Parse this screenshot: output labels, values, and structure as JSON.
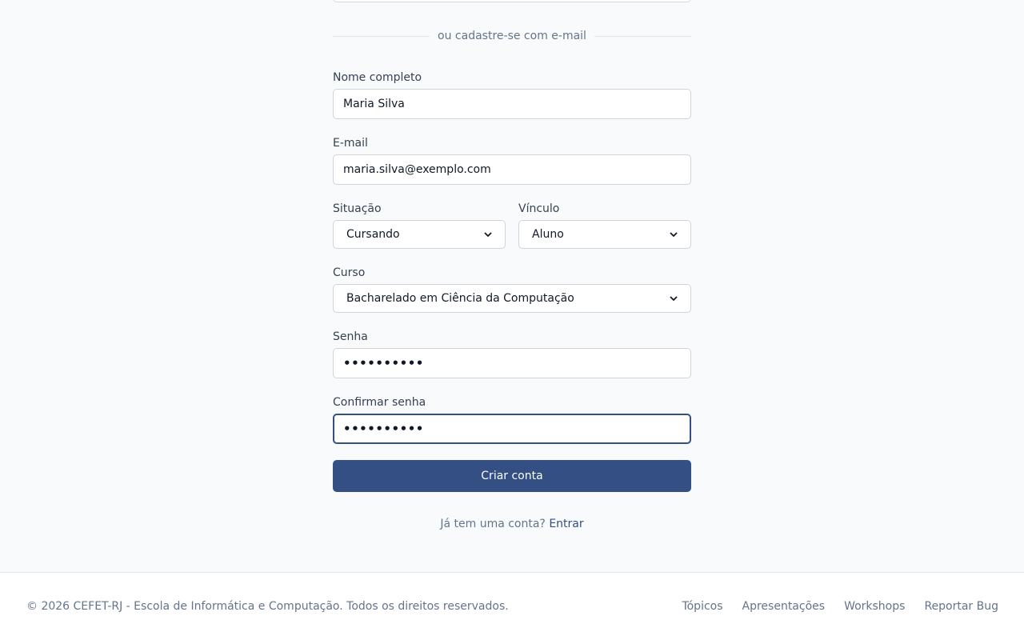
{
  "divider": {
    "text": "ou cadastre-se com e-mail"
  },
  "form": {
    "name": {
      "label": "Nome completo",
      "value": "Maria Silva"
    },
    "email": {
      "label": "E-mail",
      "value": "maria.silva@exemplo.com"
    },
    "situacao": {
      "label": "Situação",
      "selected": "Cursando"
    },
    "vinculo": {
      "label": "Vínculo",
      "selected": "Aluno"
    },
    "curso": {
      "label": "Curso",
      "selected": "Bacharelado em Ciência da Computação"
    },
    "password": {
      "label": "Senha",
      "masked": "••••••••••"
    },
    "confirm_password": {
      "label": "Confirmar senha",
      "masked": "••••••••••"
    },
    "submit_label": "Criar conta"
  },
  "login_prompt": {
    "text": "Já tem uma conta?",
    "link": "Entrar"
  },
  "footer": {
    "copyright": "© 2026 CEFET-RJ - Escola de Informática e Computação. Todos os direitos reservados.",
    "links": [
      "Tópicos",
      "Apresentações",
      "Workshops",
      "Reportar Bug"
    ]
  },
  "colors": {
    "primary": "#334f84",
    "background": "#f8fafc",
    "muted_text": "#64748b"
  }
}
